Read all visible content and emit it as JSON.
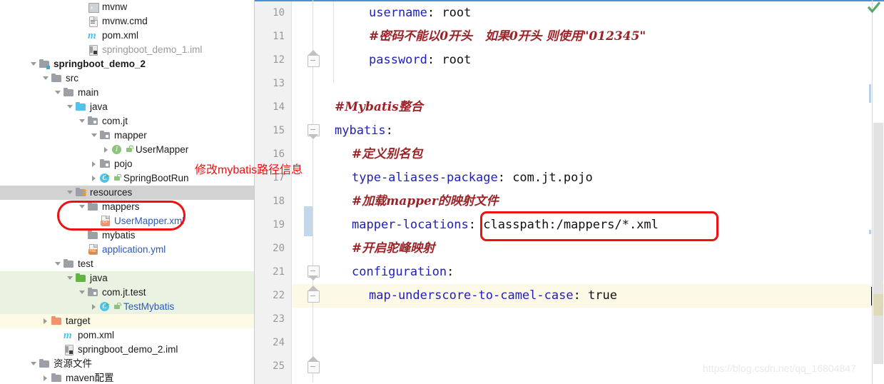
{
  "app": {
    "watermark": "https://blog.csdn.net/qq_16804847"
  },
  "sidebar": {
    "name": "project-tree",
    "scroll_visible": true,
    "items": [
      {
        "label": "mvnw",
        "icon": "script-icon",
        "indent": 5,
        "arrow": "none",
        "style": "normal"
      },
      {
        "label": "mvnw.cmd",
        "icon": "file-icon",
        "indent": 5,
        "arrow": "none",
        "style": "normal"
      },
      {
        "label": "pom.xml",
        "icon": "maven-icon",
        "indent": 5,
        "arrow": "none",
        "style": "normal"
      },
      {
        "label": "springboot_demo_1.iml",
        "icon": "module-icon",
        "indent": 5,
        "arrow": "none",
        "style": "muted"
      },
      {
        "label": "springboot_demo_2",
        "icon": "module-folder-icon",
        "indent": 1,
        "arrow": "down",
        "style": "bold"
      },
      {
        "label": "src",
        "icon": "folder-icon",
        "indent": 2,
        "arrow": "down",
        "style": "normal"
      },
      {
        "label": "main",
        "icon": "folder-icon",
        "indent": 3,
        "arrow": "down",
        "style": "normal"
      },
      {
        "label": "java",
        "icon": "source-folder-icon",
        "indent": 4,
        "arrow": "down",
        "style": "normal"
      },
      {
        "label": "com.jt",
        "icon": "package-icon",
        "indent": 5,
        "arrow": "down",
        "style": "normal"
      },
      {
        "label": "mapper",
        "icon": "package-icon",
        "indent": 6,
        "arrow": "down",
        "style": "normal"
      },
      {
        "label": "UserMapper",
        "icon": "interface-icon",
        "indent": 7,
        "arrow": "right",
        "style": "normal",
        "badge": "lock-badge"
      },
      {
        "label": "pojo",
        "icon": "package-icon",
        "indent": 6,
        "arrow": "right",
        "style": "normal"
      },
      {
        "label": "SpringBootRun",
        "icon": "class-run-icon",
        "indent": 6,
        "arrow": "right",
        "style": "normal",
        "badge": "lock-badge"
      },
      {
        "label": "resources",
        "icon": "resources-folder-icon",
        "indent": 4,
        "arrow": "down",
        "style": "normal",
        "row_highlight": "selected"
      },
      {
        "label": "mappers",
        "icon": "folder-icon",
        "indent": 5,
        "arrow": "down",
        "style": "normal"
      },
      {
        "label": "UserMapper.xml",
        "icon": "xml-file-icon",
        "indent": 6,
        "arrow": "none",
        "style": "link"
      },
      {
        "label": "mybatis",
        "icon": "folder-icon",
        "indent": 5,
        "arrow": "none",
        "style": "normal"
      },
      {
        "label": "application.yml",
        "icon": "yml-file-icon",
        "indent": 5,
        "arrow": "none",
        "style": "link"
      },
      {
        "label": "test",
        "icon": "folder-icon",
        "indent": 3,
        "arrow": "down",
        "style": "normal"
      },
      {
        "label": "java",
        "icon": "test-source-folder-icon",
        "indent": 4,
        "arrow": "down",
        "style": "normal",
        "row_highlight": "test-source"
      },
      {
        "label": "com.jt.test",
        "icon": "package-icon",
        "indent": 5,
        "arrow": "down",
        "style": "normal",
        "row_highlight": "test-source"
      },
      {
        "label": "TestMybatis",
        "icon": "class-run-icon",
        "indent": 6,
        "arrow": "right",
        "style": "link",
        "badge": "lock-badge",
        "row_highlight": "test-source"
      },
      {
        "label": "target",
        "icon": "excluded-folder-icon",
        "indent": 2,
        "arrow": "right",
        "style": "normal",
        "row_highlight": "excluded"
      },
      {
        "label": "pom.xml",
        "icon": "maven-icon",
        "indent": 3,
        "arrow": "none",
        "style": "normal"
      },
      {
        "label": "springboot_demo_2.iml",
        "icon": "module-icon",
        "indent": 3,
        "arrow": "none",
        "style": "normal"
      },
      {
        "label": "资源文件",
        "icon": "folder-icon",
        "indent": 1,
        "arrow": "down",
        "style": "normal"
      },
      {
        "label": "maven配置",
        "icon": "folder-icon",
        "indent": 2,
        "arrow": "right",
        "style": "normal"
      }
    ]
  },
  "editor": {
    "name": "yaml-editor",
    "language": "yaml",
    "first_line": 10,
    "gutter_numbers": [
      "10",
      "11",
      "12",
      "13",
      "14",
      "15",
      "16",
      "17",
      "18",
      "19",
      "20",
      "21",
      "22",
      "23",
      "24",
      "25"
    ],
    "caret_line": 22,
    "lines": [
      {
        "n": "10",
        "indent": 2,
        "type": "code",
        "key": "username",
        "sep": ": ",
        "value": "root"
      },
      {
        "n": "11",
        "indent": 2,
        "type": "comment",
        "text": "#密码不能以0开头   如果0开头 则使用\"012345\""
      },
      {
        "n": "12",
        "indent": 2,
        "type": "code",
        "key": "password",
        "sep": ": ",
        "value": "root",
        "fold": "end"
      },
      {
        "n": "13",
        "indent": 0,
        "type": "blank",
        "text": ""
      },
      {
        "n": "14",
        "indent": 0,
        "type": "comment",
        "text": "#Mybatis整合"
      },
      {
        "n": "15",
        "indent": 0,
        "type": "code",
        "key": "mybatis",
        "sep": ":",
        "value": "",
        "fold": "start"
      },
      {
        "n": "16",
        "indent": 1,
        "type": "comment",
        "text": "#定义别名包"
      },
      {
        "n": "17",
        "indent": 1,
        "type": "code",
        "key": "type-aliases-package",
        "sep": ": ",
        "value": "com.jt.pojo"
      },
      {
        "n": "18",
        "indent": 1,
        "type": "comment",
        "text": "#加载mapper的映射文件"
      },
      {
        "n": "19",
        "indent": 1,
        "type": "code",
        "key": "mapper-locations",
        "sep": ": ",
        "value": "classpath:/mappers/*.xml",
        "changed": true
      },
      {
        "n": "20",
        "indent": 1,
        "type": "comment",
        "text": "#开启驼峰映射"
      },
      {
        "n": "21",
        "indent": 1,
        "type": "code",
        "key": "configuration",
        "sep": ":",
        "value": "",
        "fold": "start"
      },
      {
        "n": "22",
        "indent": 2,
        "type": "code",
        "key": "map-underscore-to-camel-case",
        "sep": ": ",
        "value": "true",
        "fold": "end",
        "caret": true
      },
      {
        "n": "23",
        "indent": 0,
        "type": "blank",
        "text": ""
      },
      {
        "n": "24",
        "indent": 0,
        "type": "blank",
        "text": ""
      },
      {
        "n": "25",
        "indent": 0,
        "type": "blank",
        "text": "",
        "fold": "end"
      }
    ],
    "status": {
      "inspection": "ok",
      "inspection_icon": "green-check-icon"
    }
  },
  "annotations": {
    "tree_highlight_label": "mappers-usermapper-xml-highlight",
    "code_highlight_label": "mapper-locations-value-highlight",
    "note_text": "修改mybatis路径信息"
  },
  "colors": {
    "annotation_red": "#ee1111",
    "keyword_blue": "#2020c0",
    "comment_red": "#9b2226",
    "link_blue": "#2b58c4",
    "test_source_bg": "#eaf3e2",
    "excluded_bg": "#fdfae6",
    "selection_bg": "#d2d2d2",
    "changed_line_marker": "#c3d6ea",
    "caret_line_bg": "#fdf9e7"
  }
}
